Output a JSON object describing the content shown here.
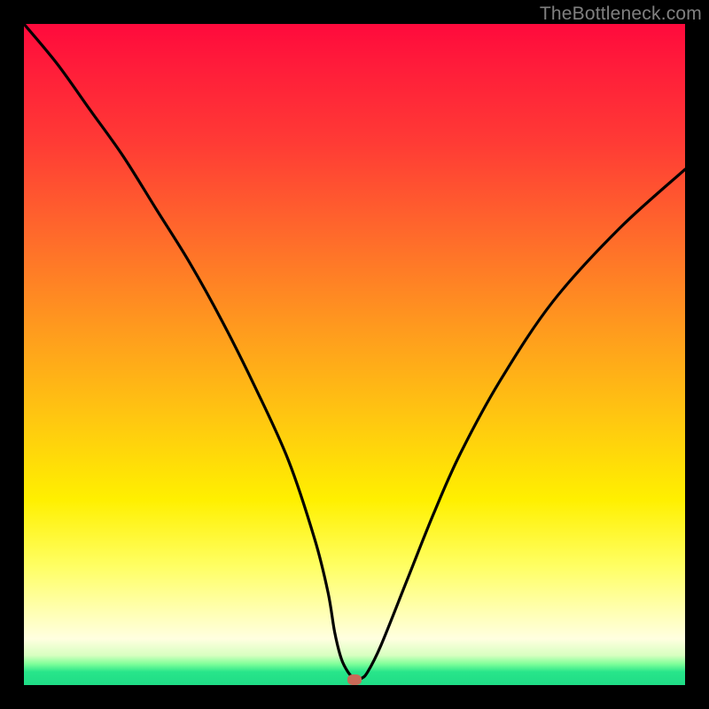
{
  "watermark": "TheBottleneck.com",
  "chart_data": {
    "type": "line",
    "title": "",
    "xlabel": "",
    "ylabel": "",
    "xlim": [
      0,
      100
    ],
    "ylim": [
      0,
      100
    ],
    "grid": false,
    "legend": false,
    "series": [
      {
        "name": "bottleneck-curve",
        "x": [
          0,
          5,
          10,
          15,
          20,
          25,
          30,
          35,
          40,
          44,
          46,
          47,
          48,
          49,
          50,
          51,
          52,
          54,
          58,
          62,
          66,
          72,
          80,
          90,
          100
        ],
        "y": [
          100,
          94,
          87,
          80,
          72,
          64,
          55,
          45,
          34,
          22,
          14,
          8,
          4,
          2,
          1,
          1,
          2,
          6,
          16,
          26,
          35,
          46,
          58,
          69,
          78
        ]
      }
    ],
    "marker": {
      "x": 50,
      "y": 0.8,
      "color": "#c96a58"
    },
    "background_gradient": {
      "top": "#ff0a3c",
      "mid": "#fff000",
      "bottom": "#1fdc86"
    }
  }
}
